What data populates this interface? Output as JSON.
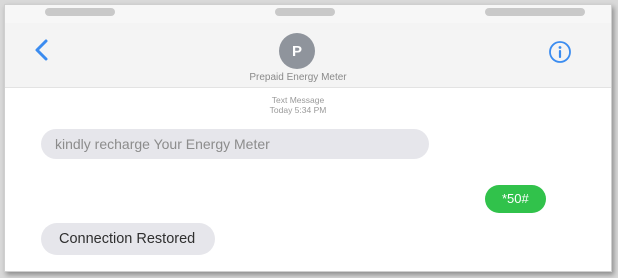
{
  "header": {
    "avatar_letter": "P",
    "contact_name": "Prepaid Energy Meter",
    "back_icon": "chevron-left-icon",
    "info_icon": "info-icon"
  },
  "thread": {
    "message_type": "Text Message",
    "timestamp": "Today 5:34 PM"
  },
  "messages": [
    {
      "direction": "incoming",
      "text": "kindly recharge Your Energy Meter"
    },
    {
      "direction": "outgoing",
      "text": "*50#"
    },
    {
      "direction": "incoming",
      "text": "Connection Restored"
    }
  ],
  "colors": {
    "accent": "#3b8cf0",
    "outgoing_bubble": "#31c24b",
    "incoming_bubble": "#e6e6eb",
    "avatar": "#8f949c"
  }
}
